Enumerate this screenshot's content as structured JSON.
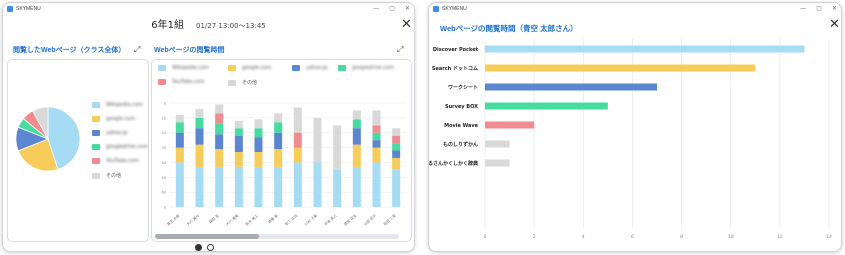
{
  "app_name": "SKYMENU",
  "window_controls": {
    "minimize": "—",
    "maximize": "▢",
    "close": "✕"
  },
  "left": {
    "class_name": "6年1組",
    "time_range": "01/27 13:00〜13:45",
    "pie_panel_title": "閲覧したWebページ（クラス全体）",
    "bar_panel_title": "Webページの閲覧時間",
    "pie_legend": [
      {
        "label": "Wikipedia.com",
        "color": "#a6dcf3"
      },
      {
        "label": "google.com",
        "color": "#f7cc5a"
      },
      {
        "label": "yahoo.jp",
        "color": "#5b86d0"
      },
      {
        "label": "googledrive.com",
        "color": "#47dba0"
      },
      {
        "label": "YouTube.com",
        "color": "#f28b8f"
      },
      {
        "label": "その他",
        "color": "#d9d9d9"
      }
    ],
    "bar_legend": [
      {
        "label": "Wikipedia.com",
        "color": "#a6dcf3"
      },
      {
        "label": "google.com",
        "color": "#f7cc5a"
      },
      {
        "label": "yahoo.jp",
        "color": "#5b86d0"
      },
      {
        "label": "googledrive.com",
        "color": "#47dba0"
      },
      {
        "label": "YouTube.com",
        "color": "#f28b8f"
      },
      {
        "label": "その他",
        "color": "#d9d9d9"
      }
    ],
    "pager": {
      "pages": 2,
      "current": 1
    }
  },
  "right": {
    "title": "Webページの閲覧時間（青空 太郎さん）"
  },
  "chart_data": [
    {
      "type": "pie",
      "title": "閲覧したWebページ（クラス全体）",
      "categories": [
        "Wikipedia.com",
        "google.com",
        "yahoo.jp",
        "googledrive.com",
        "YouTube.com",
        "その他"
      ],
      "values": [
        45,
        24,
        12,
        5,
        6,
        8
      ],
      "colors": [
        "#a6dcf3",
        "#f7cc5a",
        "#5b86d0",
        "#47dba0",
        "#f28b8f",
        "#d9d9d9"
      ]
    },
    {
      "type": "bar",
      "stacked": true,
      "title": "Webページの閲覧時間",
      "categories": [
        "青空 太郎",
        "大川 翼斗",
        "森田 花",
        "大川 恵美",
        "鈴木 美人",
        "佐藤 美",
        "松下 庄司",
        "川村 子美",
        "中本 秀人",
        "西宮 花音",
        "山田 花子",
        "名田 三花"
      ],
      "series": [
        {
          "name": "Wikipedia.com",
          "color": "#a6dcf3",
          "values": [
            3.0,
            2.7,
            2.7,
            2.7,
            2.7,
            2.7,
            3.0,
            3.0,
            2.5,
            2.7,
            3.0,
            2.5
          ]
        },
        {
          "name": "google.com",
          "color": "#f7cc5a",
          "values": [
            1.0,
            1.5,
            1.2,
            1.0,
            1.0,
            1.2,
            1.0,
            0,
            0,
            1.5,
            1.0,
            0.8
          ]
        },
        {
          "name": "yahoo.jp",
          "color": "#5b86d0",
          "values": [
            1.0,
            1.1,
            1.0,
            1.1,
            1.0,
            1.1,
            0,
            0,
            0,
            1.1,
            0.5,
            0.5
          ]
        },
        {
          "name": "googledrive.com",
          "color": "#47dba0",
          "values": [
            0.7,
            0.7,
            0.7,
            0.5,
            0.6,
            0.7,
            0,
            0,
            0,
            0.6,
            0.5,
            0.5
          ]
        },
        {
          "name": "YouTube.com",
          "color": "#f28b8f",
          "values": [
            0,
            0,
            0.7,
            0,
            0,
            0,
            1.0,
            0,
            0,
            0,
            0.5,
            0.5
          ]
        },
        {
          "name": "その他",
          "color": "#d9d9d9",
          "values": [
            0.5,
            0.6,
            0.6,
            0.5,
            0.6,
            0.6,
            1.7,
            3.0,
            3.0,
            0.6,
            1.0,
            0.5
          ]
        }
      ],
      "ytick_labels": [
        "0",
        "60",
        "50",
        "40",
        "30",
        "20",
        "10",
        "0"
      ],
      "ylim": [
        0,
        7
      ]
    },
    {
      "type": "bar",
      "orientation": "horizontal",
      "title": "Webページの閲覧時間（青空 太郎さん）",
      "categories": [
        "Discover Pocket",
        "Search ドットコム",
        "ワークシート",
        "Survey BOX",
        "Movie Wave",
        "ものしりずかん",
        "まるさんかくしかく辞典"
      ],
      "values": [
        13,
        11,
        7,
        5,
        2,
        1,
        1
      ],
      "colors": [
        "#a6dcf3",
        "#f7cc5a",
        "#5b86d0",
        "#47dba0",
        "#f28b8f",
        "#d9d9d9",
        "#d9d9d9"
      ],
      "xticks": [
        0,
        2,
        4,
        6,
        8,
        10,
        12,
        14
      ],
      "xlim": [
        0,
        14
      ],
      "grid": true
    }
  ]
}
